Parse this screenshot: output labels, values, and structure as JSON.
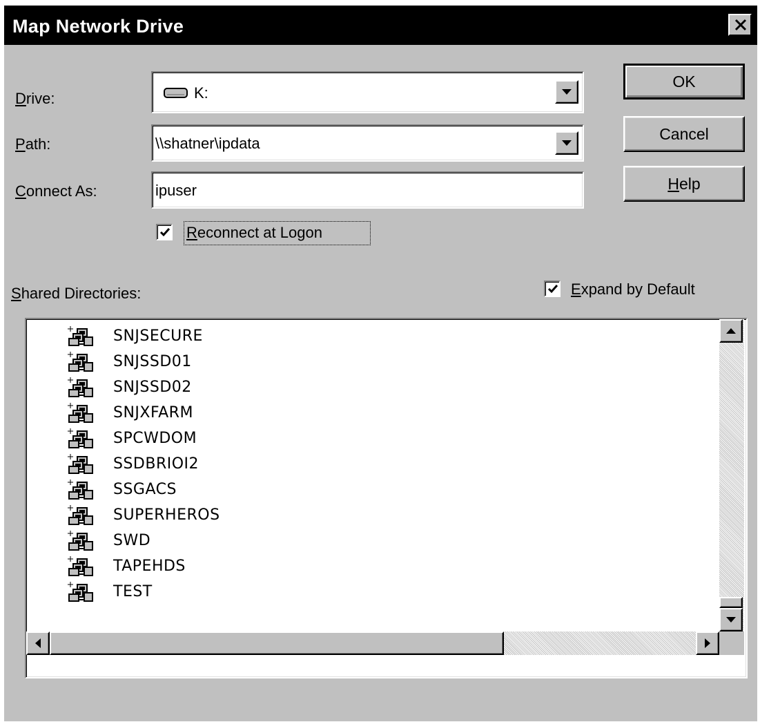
{
  "window": {
    "title": "Map Network Drive"
  },
  "form": {
    "drive_label_mnemonic": "D",
    "drive_label_rest": "rive:",
    "drive_value": "K:",
    "path_label_mnemonic": "P",
    "path_label_rest": "ath:",
    "path_value": "\\\\shatner\\ipdata",
    "connect_label_mnemonic": "C",
    "connect_label_rest": "onnect As:",
    "connect_value": "ipuser",
    "reconnect_checked": true,
    "reconnect_label_mnemonic": "R",
    "reconnect_label_rest": "econnect at Logon"
  },
  "buttons": {
    "ok_label": "OK",
    "cancel_label": "Cancel",
    "help_label_mnemonic": "H",
    "help_label_rest": "elp"
  },
  "shared": {
    "label_mnemonic": "S",
    "label_rest": "hared Directories:",
    "expand_checked": true,
    "expand_label_mnemonic": "E",
    "expand_label_rest": "xpand by Default",
    "items": [
      "SNJSECURE",
      "SNJSSD01",
      "SNJSSD02",
      "SNJXFARM",
      "SPCWDOM",
      "SSDBRIOI2",
      "SSGACS",
      "SUPERHEROS",
      "SWD",
      "TAPEHDS",
      "TEST"
    ],
    "item_icon": "network-domain-icon"
  },
  "colors": {
    "face": "#c0c0c0",
    "titlebar": "#000000",
    "titletext": "#ffffff",
    "field": "#ffffff"
  }
}
